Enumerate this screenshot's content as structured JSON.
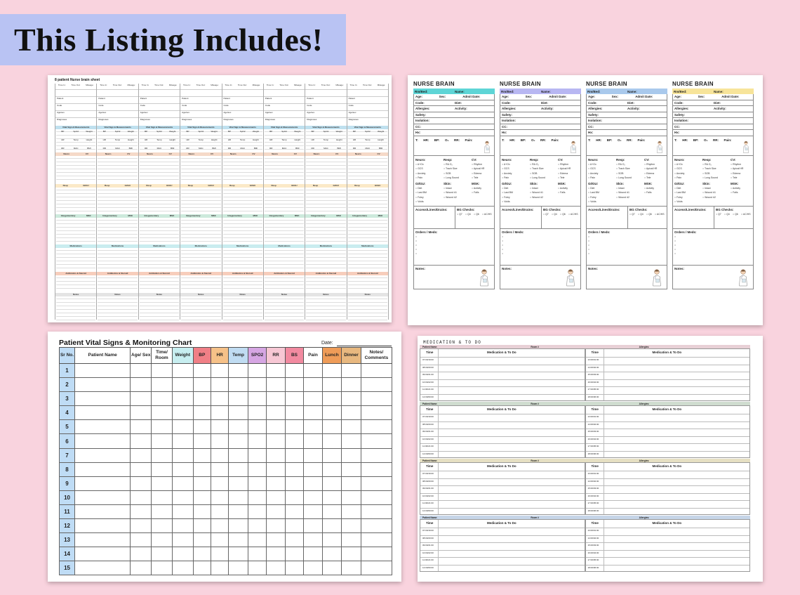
{
  "banner": {
    "title": "This Listing Includes!"
  },
  "brain8": {
    "title": "8 patient  Nurse brain sheet",
    "header_cells": [
      "Time In:",
      "Time Out:",
      "Mileage:"
    ],
    "row_labels": [
      "Patient",
      "Code",
      "Age/sex",
      "Diagnoses",
      "Allergies"
    ],
    "sections": [
      {
        "label": "Vital Sign & Measurements",
        "color": "#bfe0ef"
      },
      {
        "label": "Neuro",
        "color": "#f5d9c8"
      },
      {
        "label": "Resp",
        "color": "#fbe9c8"
      },
      {
        "label": "Integumentary",
        "color": "#cdeadc"
      },
      {
        "label": "Medications",
        "color": "#c9ecef"
      },
      {
        "label": "Antibiotics & Steroid",
        "color": "#f7cdbb"
      },
      {
        "label": "Notes",
        "color": "#e4e4e4"
      }
    ],
    "section_pairs": [
      [
        "Neuro",
        "CV"
      ],
      [
        "Resp",
        "GI/GU"
      ],
      [
        "Integumentary",
        "MSK"
      ]
    ],
    "vitals": [
      "BP",
      "SpO2",
      "Weight",
      "HR",
      "Temp",
      "Height",
      "RR",
      "MAC",
      "BMI"
    ],
    "notes_label": "Notes"
  },
  "nurse_brain": {
    "title": "NURSE BRAIN",
    "colors": [
      "#5ed5d6",
      "#b8b7f2",
      "#a9c9ec",
      "#f7e49a"
    ],
    "fields": {
      "rm_bed": "Rm/Bed:",
      "name": "Name:",
      "age": "Age:",
      "sex": "Sex:",
      "admit": "Admit Date:",
      "code": "Code:",
      "diet": "Diet:",
      "allergies": "Allergies:",
      "activity": "Activity:",
      "safety": "Safety:",
      "isolation": "Isolation:",
      "cc": "CC:",
      "hx": "Hx:",
      "vitals": "T:      HR:      BP:      O₂      RR:      Pain:",
      "neuro": "Neuro:",
      "resp": "Resp:",
      "cv": "CV:",
      "gi_gu": "GI/GU:",
      "skin": "Skin:",
      "msk": "MSK:",
      "access": "Access/Lines/Drains:",
      "bg": "BG Checks:",
      "orders": "Orders / Meds:",
      "notes": "Notes:"
    },
    "neuro_items": [
      "A+Ox",
      "GCS",
      "Anxiety",
      "Pain"
    ],
    "resp_items": [
      "RA  O₂",
      "Trach Size",
      "SOB",
      "Lung Sound"
    ],
    "cv_items": [
      "Rhythm",
      "Apical HR",
      "Edema",
      "Tele"
    ],
    "gi_items": [
      "Diet",
      "Last BM",
      "Foley",
      "Voids"
    ],
    "skin_items": [
      "Intact",
      "Wound #1",
      "Wound #2"
    ],
    "msk_items": [
      "Activity",
      "Falls"
    ],
    "bg_items": [
      "Q7",
      "Q4",
      "Q6",
      "AC/HS"
    ]
  },
  "vital_chart": {
    "title": "Patient Vital Signs & Monitoring Chart",
    "date_label": "Date:",
    "columns": [
      {
        "label": "Sr No.",
        "color": "#bfdcf5"
      },
      {
        "label": "Patient Name",
        "color": "#ffffff"
      },
      {
        "label": "Age/ Sex",
        "color": "#ffffff"
      },
      {
        "label": "Time/ Room",
        "color": "#ffffff"
      },
      {
        "label": "Weight",
        "color": "#c7eef0"
      },
      {
        "label": "BP",
        "color": "#f07f86"
      },
      {
        "label": "HR",
        "color": "#f6c188"
      },
      {
        "label": "Temp",
        "color": "#c0dcf2"
      },
      {
        "label": "SPO2",
        "color": "#d6a6e3"
      },
      {
        "label": "RR",
        "color": "#f7c7d4"
      },
      {
        "label": "BS",
        "color": "#f28aa0"
      },
      {
        "label": "Pain",
        "color": "#ffffff"
      },
      {
        "label": "Lunch",
        "color": "#ef9c58"
      },
      {
        "label": "Dinner",
        "color": "#e8b87f"
      },
      {
        "label": "Notes/ Comments",
        "color": "#ffffff"
      }
    ],
    "rows": [
      "1",
      "2",
      "3",
      "4",
      "5",
      "6",
      "7",
      "8",
      "9",
      "10",
      "11",
      "12",
      "13",
      "14",
      "15"
    ]
  },
  "med_todo": {
    "title": "MEDICATION & TO DO",
    "header": {
      "patient": "Patient Name:",
      "room": "Room #",
      "allergies": "Allergies:"
    },
    "col_time": "Time",
    "col_med": "Medication & To Do",
    "section_colors": [
      "#e8d0d6",
      "#cfdccf",
      "#e6e0c3",
      "#c6d5e8"
    ],
    "times_left": [
      "07:00/19:00",
      "08:00/20:00",
      "09:00/21:00",
      "10:00/22:00",
      "11:00/21:00",
      "12:00/00:00"
    ],
    "times_right": [
      "13:00/01:00",
      "14:00/02:00",
      "15:00/03:00",
      "16:00/04:00",
      "17:00/05:00",
      "18:00/06:00"
    ]
  }
}
